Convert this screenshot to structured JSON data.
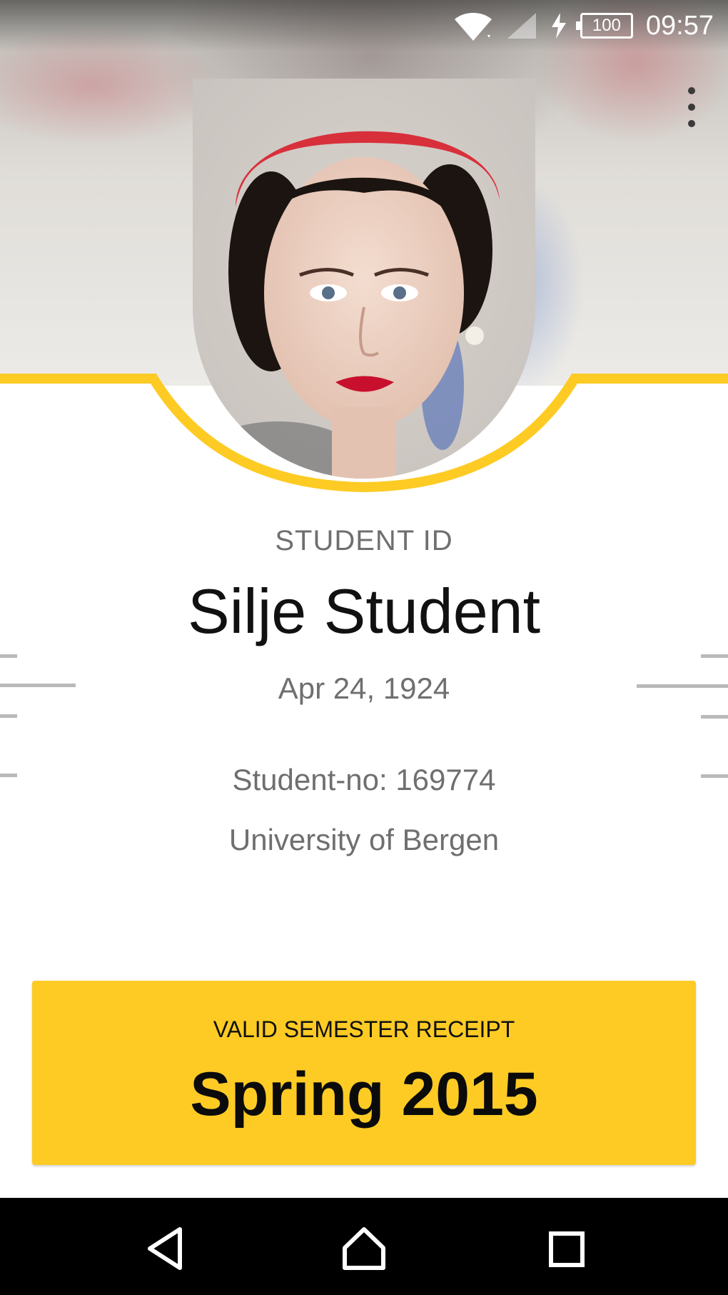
{
  "status_bar": {
    "time": "09:57",
    "battery": "100",
    "icons": [
      "wifi-icon",
      "signal-icon",
      "charging-icon",
      "battery-icon"
    ]
  },
  "menu": {
    "icon": "overflow-menu-icon"
  },
  "photo": {
    "icon": "student-portrait"
  },
  "card": {
    "label": "STUDENT ID",
    "name": "Silje Student",
    "birth_date": "Apr 24, 1924",
    "student_no": "Student-no: 169774",
    "university": "University of Bergen"
  },
  "receipt": {
    "label": "VALID SEMESTER RECEIPT",
    "term": "Spring 2015"
  },
  "navigation": {
    "buttons": [
      "back-icon",
      "home-icon",
      "recents-icon"
    ]
  },
  "colors": {
    "accent": "#fdcb24",
    "text_primary": "#111111",
    "text_secondary": "#6f6f6f",
    "nav_background": "#000000"
  }
}
